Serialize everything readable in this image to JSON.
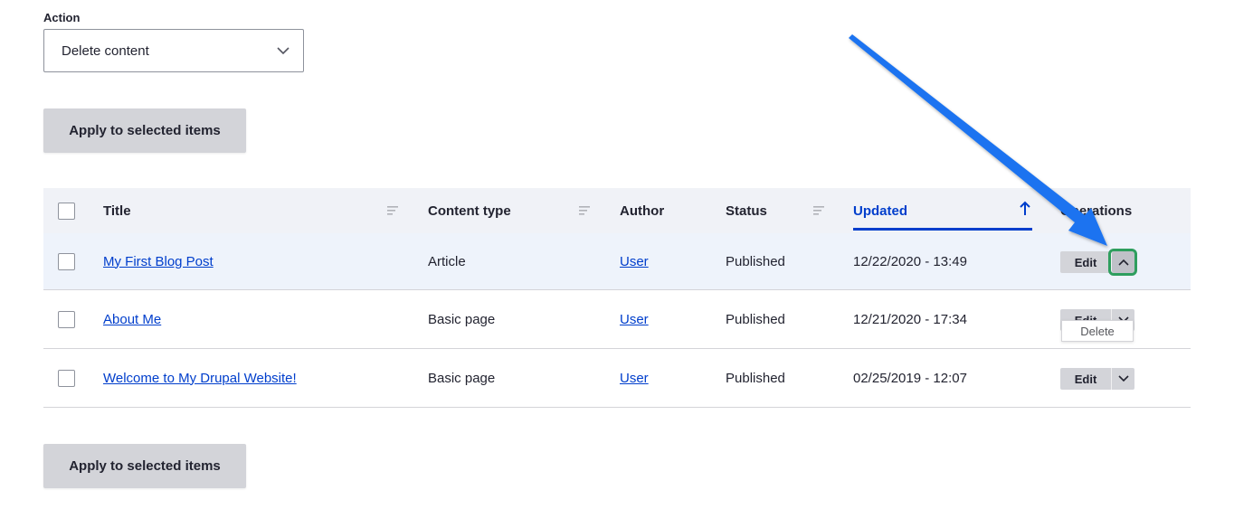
{
  "action": {
    "label": "Action",
    "selected": "Delete content"
  },
  "apply_button_label": "Apply to selected items",
  "table": {
    "columns": {
      "title": "Title",
      "content_type": "Content type",
      "author": "Author",
      "status": "Status",
      "updated": "Updated",
      "operations": "Operations"
    },
    "sorted_column": "Updated",
    "sort_direction": "ascending",
    "rows": [
      {
        "title": "My First Blog Post",
        "content_type": "Article",
        "author": "User",
        "status": "Published",
        "updated": "12/22/2020 - 13:49",
        "edit_label": "Edit",
        "dropdown_open": true,
        "dropdown_item": "Delete"
      },
      {
        "title": "About Me",
        "content_type": "Basic page",
        "author": "User",
        "status": "Published",
        "updated": "12/21/2020 - 17:34",
        "edit_label": "Edit",
        "dropdown_open": false
      },
      {
        "title": "Welcome to My Drupal Website!",
        "content_type": "Basic page",
        "author": "User",
        "status": "Published",
        "updated": "02/25/2019 - 12:07",
        "edit_label": "Edit",
        "dropdown_open": false
      }
    ]
  },
  "colors": {
    "link": "#003ecc",
    "header_bg": "#f0f2f7",
    "button_bg": "#d3d4d9",
    "focus_outline": "#2e9e5e",
    "annotation_arrow": "#1a73f0"
  }
}
